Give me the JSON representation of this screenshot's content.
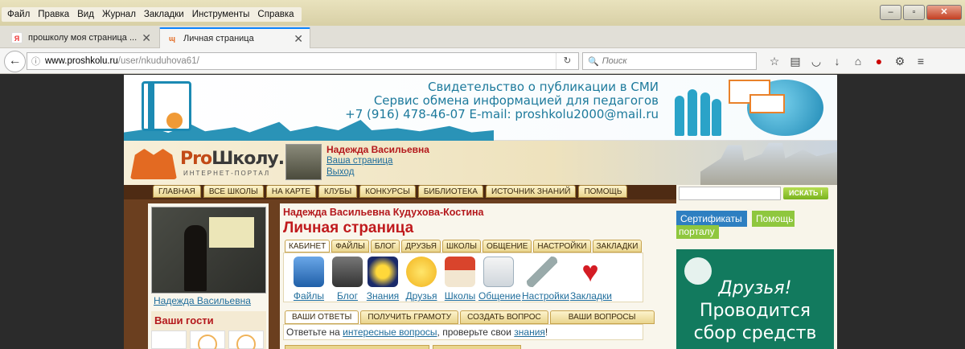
{
  "menu": [
    "Файл",
    "Правка",
    "Вид",
    "Журнал",
    "Закладки",
    "Инструменты",
    "Справка"
  ],
  "tabs": [
    {
      "title": "прошколу моя страница ...",
      "icon": "yandex-icon"
    },
    {
      "title": "Личная страница",
      "icon": "proshkolu-icon",
      "active": true
    }
  ],
  "url": {
    "host": "www.proshkolu.ru",
    "path": "/user/nkuduhova61/"
  },
  "search_placeholder": "Поиск",
  "banner": {
    "line1": "Свидетельство о публикации в СМИ",
    "line2": "Сервис обмена информацией для педагогов",
    "line3": "+7 (916) 478-46-07 E-mail: proshkolu2000@mail.ru"
  },
  "logo": {
    "pro": "Pro",
    "name": "Школу.ru",
    "sub": "ИНТЕРНЕТ-ПОРТАЛ"
  },
  "user": {
    "name": "Надежда Васильевна",
    "page_link": "Ваша страница",
    "logout": "Выход"
  },
  "nav": [
    "ГЛАВНАЯ",
    "ВСЕ ШКОЛЫ",
    "НА КАРТЕ",
    "КЛУБЫ",
    "КОНКУРСЫ",
    "БИБЛИОТЕКА",
    "ИСТОЧНИК ЗНАНИЙ",
    "ПОМОЩЬ"
  ],
  "search_button": "ИСКАТЬ !",
  "side_buttons": {
    "certificates": "Сертификаты",
    "help": "Помощь",
    "portal": "порталу"
  },
  "charity": {
    "line1": "Друзья!",
    "line2": "Проводится",
    "line3": "сбор средств"
  },
  "profile": {
    "caption": "Надежда Васильевна",
    "guests_title": "Ваши гости"
  },
  "main": {
    "fullname": "Надежда Васильевна Кудухова-Костина",
    "title": "Личная страница",
    "subtabs": [
      "КАБИНЕТ",
      "ФАЙЛЫ",
      "БЛОГ",
      "ДРУЗЬЯ",
      "ШКОЛЫ",
      "ОБЩЕНИЕ",
      "НАСТРОЙКИ",
      "ЗАКЛАДКИ"
    ],
    "icons": [
      "Файлы",
      "Блог",
      "Знания",
      "Друзья",
      "Школы",
      "Общение",
      "Настройки",
      "Закладки"
    ],
    "qtabs": [
      "ВАШИ ОТВЕТЫ",
      "ПОЛУЧИТЬ ГРАМОТУ",
      "СОЗДАТЬ ВОПРОС",
      "ВАШИ ВОПРОСЫ"
    ],
    "qline": {
      "a": "Ответьте на ",
      "link1": "интересные вопросы",
      "b": ", проверьте свои ",
      "link2": "знания",
      "c": "!"
    }
  }
}
